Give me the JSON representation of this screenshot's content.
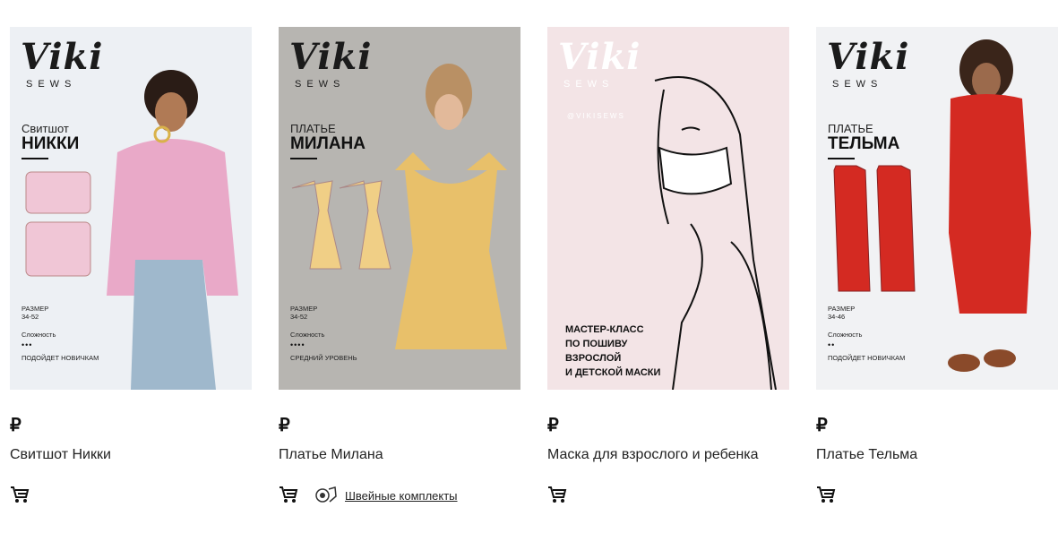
{
  "products": [
    {
      "brand": "Viki",
      "brand_sub": "SEWS",
      "cover_type": "Свитшот",
      "cover_name": "НИККИ",
      "size_label": "РАЗМЕР",
      "size_value": "34-52",
      "complexity_label": "Сложность",
      "complexity_dots": "•••",
      "level": "ПОДОЙДЕТ НОВИЧКАМ",
      "price": "₽",
      "title": "Свитшот Никки",
      "cart_icon": "cart-icon"
    },
    {
      "brand": "Viki",
      "brand_sub": "SEWS",
      "cover_type": "ПЛАТЬЕ",
      "cover_name": "МИЛАНА",
      "size_label": "РАЗМЕР",
      "size_value": "34-52",
      "complexity_label": "Сложность",
      "complexity_dots": "••••",
      "level": "СРЕДНИЙ УРОВЕНЬ",
      "price": "₽",
      "title": "Платье Милана",
      "cart_icon": "cart-icon",
      "kit_link": "Швейные комплекты"
    },
    {
      "brand": "Viki",
      "brand_sub": "SEWS",
      "handle": "@VIKISEWS",
      "caption_lines": [
        "МАСТЕР-КЛАСС",
        "ПО ПОШИВУ",
        "ВЗРОСЛОЙ",
        "И ДЕТСКОЙ МАСКИ"
      ],
      "price": "₽",
      "title": "Маска для взрослого и ребенка",
      "cart_icon": "cart-icon"
    },
    {
      "brand": "Viki",
      "brand_sub": "SEWS",
      "cover_type": "ПЛАТЬЕ",
      "cover_name": "ТЕЛЬМА",
      "size_label": "РАЗМЕР",
      "size_value": "34-46",
      "complexity_label": "Сложность",
      "complexity_dots": "••",
      "level": "ПОДОЙДЕТ НОВИЧКАМ",
      "price": "₽",
      "title": "Платье Тельма",
      "cart_icon": "cart-icon"
    }
  ],
  "colors": {
    "pink_sweatshirt": "#e9a9c8",
    "yellow_dress": "#e8c06a",
    "red_dress": "#d42a22",
    "mask_bg": "#f3e4e6"
  }
}
